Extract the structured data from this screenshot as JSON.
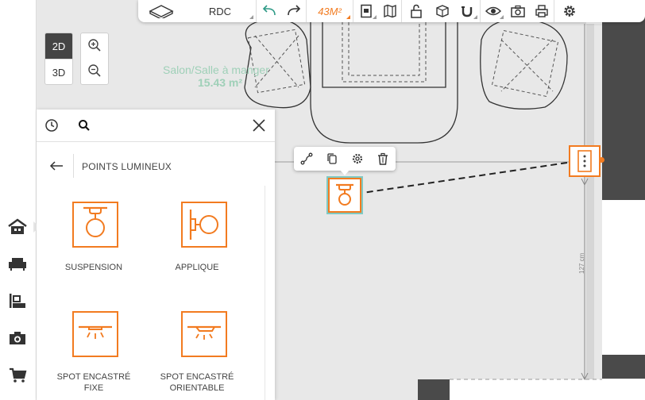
{
  "toolbar": {
    "floor_label": "RDC",
    "area_label": "43M²",
    "colors": {
      "accent": "#f27b20",
      "undo": "#2e9a86"
    }
  },
  "view": {
    "mode_2d": "2D",
    "mode_3d": "3D",
    "active": "2D"
  },
  "plan": {
    "room_name": "Salon/Salle à manger",
    "room_area": "15.43 m²",
    "dimension_label": "127 cm"
  },
  "panel": {
    "title": "POINTS LUMINEUX",
    "items": [
      {
        "label": "SUSPENSION",
        "icon": "pendant-light-icon"
      },
      {
        "label": "APPLIQUE",
        "icon": "wall-light-icon"
      },
      {
        "label": "SPOT ENCASTRÉ\nFIXE",
        "line1": "SPOT ENCASTRÉ",
        "line2": "FIXE",
        "icon": "recessed-spot-fixed-icon"
      },
      {
        "label": "SPOT ENCASTRÉ\nORIENTABLE",
        "line1": "SPOT ENCASTRÉ",
        "line2": "ORIENTABLE",
        "icon": "recessed-spot-adjustable-icon"
      }
    ]
  },
  "sidebar": {
    "items": [
      {
        "icon": "house-icon"
      },
      {
        "icon": "sofa-icon"
      },
      {
        "icon": "room-decor-icon"
      },
      {
        "icon": "camera-icon"
      },
      {
        "icon": "cart-icon"
      }
    ]
  }
}
